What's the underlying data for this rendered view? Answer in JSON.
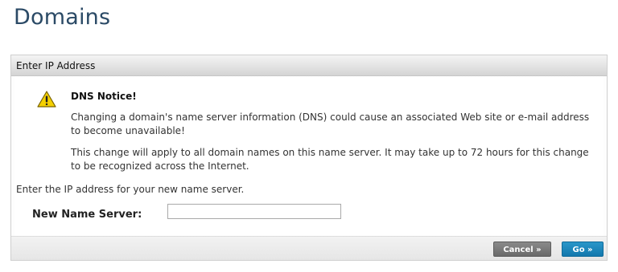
{
  "page": {
    "title": "Domains"
  },
  "panel": {
    "header": "Enter IP Address",
    "notice": {
      "icon": "warning-icon",
      "title": "DNS Notice!",
      "paragraph1": "Changing a domain's name server information (DNS) could cause an associated Web site or e-mail address to become unavailable!",
      "paragraph2": "This change will apply to all domain names on this name server. It may take up to 72 hours for this change to be recognized across the Internet."
    },
    "instruction": "Enter the IP address for your new name server.",
    "name_server": {
      "label": "New Name Server:",
      "value": "",
      "placeholder": ""
    }
  },
  "buttons": {
    "cancel": "Cancel »",
    "go": "Go »"
  },
  "colors": {
    "title": "#2b4a66",
    "go_button": "#1a86bd",
    "cancel_button": "#7a7a7a",
    "warning_yellow": "#f5d000"
  }
}
